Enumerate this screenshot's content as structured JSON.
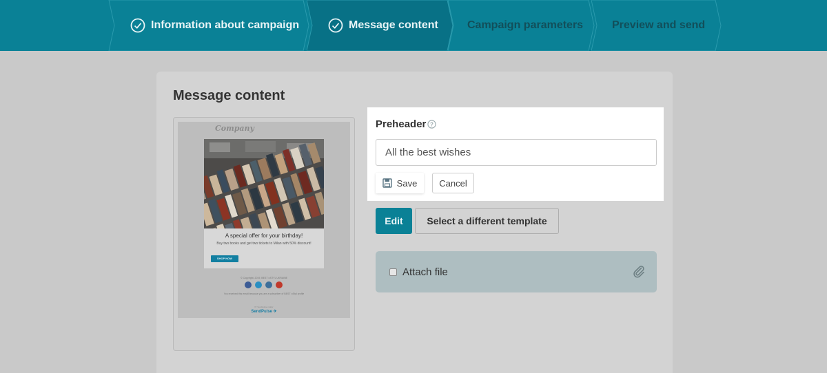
{
  "stepper": {
    "steps": [
      {
        "label": "Information about campaign",
        "status": "done",
        "icon": "check-circle-icon"
      },
      {
        "label": "Message content",
        "status": "active",
        "icon": "check-circle-icon"
      },
      {
        "label": "Campaign parameters",
        "status": "todo"
      },
      {
        "label": "Preview and send",
        "status": "todo"
      }
    ]
  },
  "main": {
    "title": "Message content"
  },
  "template_preview": {
    "logo": "Company",
    "headline": "A special offer for your birthday!",
    "text": "Buy two books and get two tickets to Milan with 50% discount!",
    "button": "SHOP NOW",
    "copyright": "© Copyright, 2019, BEST ••STYL UKRAINE",
    "social_icons": [
      "facebook-icon",
      "twitter-icon",
      "vk-icon",
      "youtube-icon"
    ],
    "note": "You received this email because you are a subscriber of BEST ••Styl profile",
    "powered_by": "Pr Sendpulse.mailer",
    "brand": "SendPulse ✈"
  },
  "preheader": {
    "label": "Preheader",
    "value": "All the best wishes",
    "save_label": "Save",
    "cancel_label": "Cancel"
  },
  "actions": {
    "edit_label": "Edit",
    "template_label": "Select a different template"
  },
  "attach": {
    "label": "Attach file",
    "checked": false
  },
  "colors": {
    "header_bg": "#0a8196",
    "accent": "#0a8196",
    "overlay": "#c9c9c9",
    "highlight": "#ffffff"
  }
}
